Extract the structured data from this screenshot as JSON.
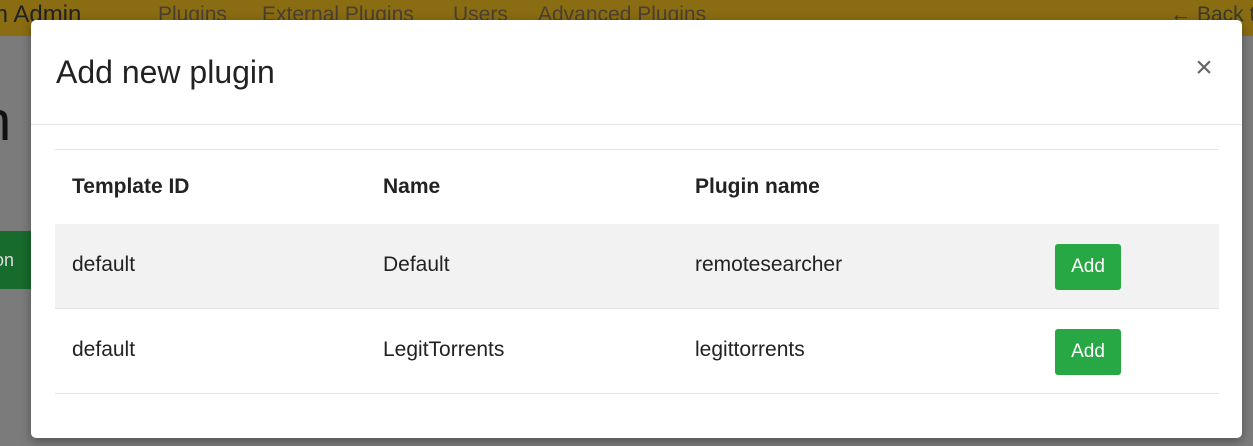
{
  "navbar": {
    "brand": "m Admin",
    "links": [
      "Plugins",
      "External Plugins",
      "Users",
      "Advanced Plugins"
    ],
    "back": "← Back to"
  },
  "background": {
    "heading": "n",
    "button_fragment": "on"
  },
  "modal": {
    "title": "Add new plugin",
    "close_label": "×",
    "columns": [
      "Template ID",
      "Name",
      "Plugin name"
    ],
    "rows": [
      {
        "template_id": "default",
        "name": "Default",
        "plugin_name": "remotesearcher",
        "action": "Add"
      },
      {
        "template_id": "default",
        "name": "LegitTorrents",
        "plugin_name": "legittorrents",
        "action": "Add"
      }
    ]
  },
  "colors": {
    "navbar": "#8a6c12",
    "overlay": "#7b7b7b",
    "add_button": "#28a745"
  }
}
